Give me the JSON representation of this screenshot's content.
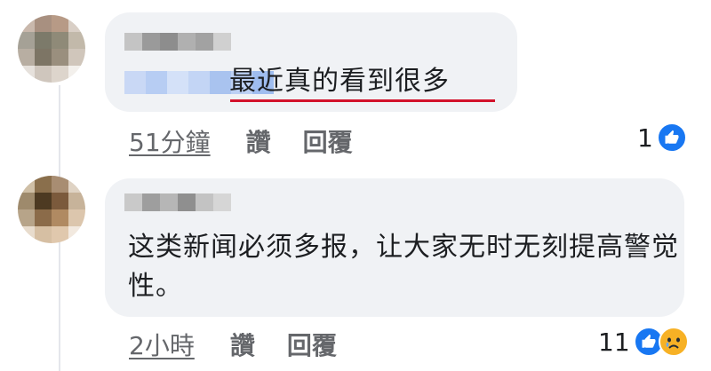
{
  "colors": {
    "bubble": "#f0f2f5",
    "meta_text": "#65676b",
    "like_blue": "#1877f2",
    "highlight_underline": "#d3122b"
  },
  "comments": [
    {
      "avatar_blur": [
        "#c9b8ac",
        "#a89080",
        "#b79a86",
        "#d9cfc6",
        "#a5a196",
        "#7c7a6a",
        "#8f8a78",
        "#c2b9aa",
        "#b8aea2",
        "#7d7565",
        "#9a8f7e",
        "#d0c6bb",
        "#e6e1dc",
        "#cfc6bd",
        "#ddd5cc",
        "#f3f0ec"
      ],
      "name_blur": [
        "#c4c4c4",
        "#9a9a9a",
        "#8d8d8d",
        "#b0b0b0",
        "#a2a2a2",
        "#d0d0d0"
      ],
      "mention_blur": [
        "#c9d8f5",
        "#b7cdf3",
        "#d4e1f8",
        "#c3d5f5",
        "#a9c3ef",
        "#bcd0f4",
        "#9fbdef"
      ],
      "text": "最近真的看到很多",
      "time": "51分鐘",
      "like_label": "讚",
      "reply_label": "回覆",
      "reaction_count": "1",
      "reaction_icons": [
        "like-icon"
      ]
    },
    {
      "avatar_blur": [
        "#cfbfa6",
        "#8a6f4c",
        "#a88d72",
        "#dfd3c4",
        "#9e8a6c",
        "#4d3a22",
        "#7b5a3c",
        "#c7b39a",
        "#b7a489",
        "#8b6b49",
        "#b08a62",
        "#dcc6ad",
        "#e8dccd",
        "#d6bfa3",
        "#e0c8ad",
        "#f2e9df"
      ],
      "name_blur": [
        "#c9c9c9",
        "#9e9e9e",
        "#b6b6b6",
        "#8f8f8f",
        "#c3c3c3",
        "#d6d6d6"
      ],
      "text": "这类新闻必须多报，让大家无时无刻提高警觉性。",
      "time": "2小時",
      "like_label": "讚",
      "reply_label": "回覆",
      "reaction_count": "11",
      "reaction_icons": [
        "like-icon",
        "sad-icon"
      ]
    }
  ]
}
